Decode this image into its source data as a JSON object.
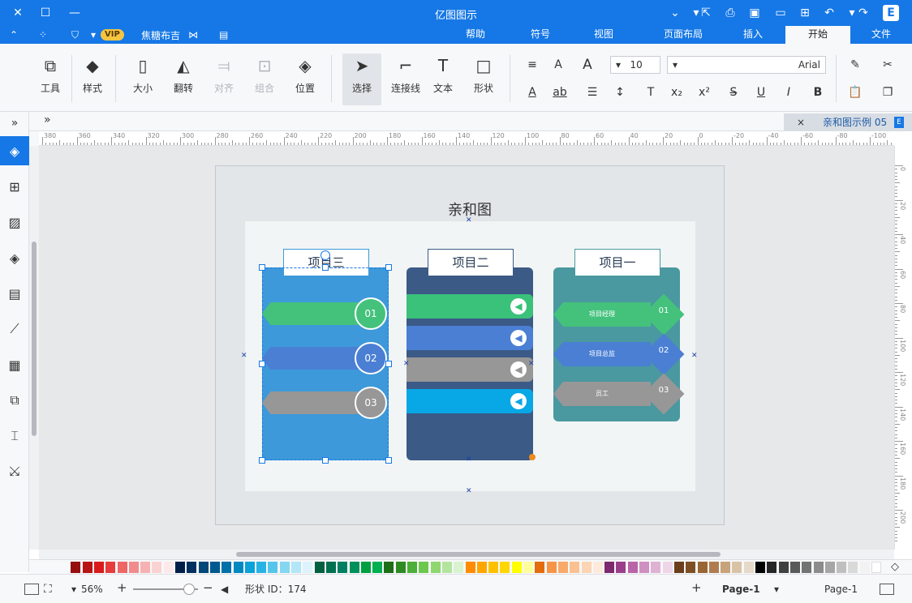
{
  "app_title": "亿图图示",
  "menu_tabs": [
    "文件",
    "开始",
    "插入",
    "页面布局",
    "视图",
    "符号",
    "帮助"
  ],
  "active_tab": "开始",
  "user": {
    "name": "焦糖布吉",
    "vip": "VIP"
  },
  "ribbon": {
    "groups": [
      {
        "label": "工具"
      },
      {
        "label": "样式"
      },
      {
        "label": "大小"
      },
      {
        "label": "翻转"
      },
      {
        "label": "对齐",
        "disabled": true
      },
      {
        "label": "组合",
        "disabled": true
      },
      {
        "label": "位置"
      },
      {
        "label": "选择"
      },
      {
        "label": "连接线"
      },
      {
        "label": "文本"
      },
      {
        "label": "形状"
      }
    ],
    "font_size": "10",
    "font_name": "Arial"
  },
  "document_tab": "亲和图示例 05",
  "ruler": {
    "h_labels": [
      "380",
      "360",
      "340",
      "320",
      "300",
      "280",
      "260",
      "240",
      "220",
      "200",
      "180",
      "160",
      "140",
      "120",
      "100",
      "80",
      "60",
      "40",
      "20",
      "0",
      "-20",
      "-40",
      "-60",
      "-80",
      "-100"
    ],
    "v_labels": [
      "0",
      "20",
      "40",
      "60",
      "80",
      "100",
      "120",
      "140",
      "160",
      "180",
      "200"
    ]
  },
  "diagram": {
    "title": "亲和图",
    "panels": [
      {
        "header": "项目三",
        "color": "#3d99d9",
        "items": [
          {
            "num": "01",
            "color": "#44c27c"
          },
          {
            "num": "02",
            "color": "#4a7fd4"
          },
          {
            "num": "03",
            "color": "#979797"
          }
        ]
      },
      {
        "header": "项目二",
        "color": "#3b5a86",
        "bars": [
          "#3ac17a",
          "#4a7fd4",
          "#979797",
          "#08a7e6"
        ]
      },
      {
        "header": "项目一",
        "color": "#4a98a0",
        "items": [
          {
            "num": "01",
            "label": "项目经理",
            "color": "#44c27c"
          },
          {
            "num": "02",
            "label": "项目总监",
            "color": "#4a7fd4"
          },
          {
            "num": "03",
            "label": "员工",
            "color": "#979797"
          }
        ]
      }
    ]
  },
  "status": {
    "zoom": "56%",
    "shape_id": "形状 ID：174",
    "page_current": "Page-1",
    "page_list": "Page-1"
  },
  "palette_colors": [
    "#ffffff",
    "#f2f2f2",
    "#d9d9d9",
    "#bfbfbf",
    "#a6a6a6",
    "#8c8c8c",
    "#737373",
    "#595959",
    "#404040",
    "#262626",
    "#000000",
    "#e6d9c7",
    "#d9c3a5",
    "#c7a27a",
    "#b07c4f",
    "#996633",
    "#7f4f24",
    "#6b3e1b",
    "#efd5e8",
    "#dfb1d3",
    "#cf8fc0",
    "#b964a8",
    "#9c3f8b",
    "#7d2a6e",
    "#fdeada",
    "#fcd5b5",
    "#fbc08f",
    "#f9a96a",
    "#f79546",
    "#e46c0a",
    "#ffff99",
    "#ffff00",
    "#ffd700",
    "#ffc000",
    "#ffa500",
    "#ff8c00",
    "#d9f2d0",
    "#b3e59f",
    "#8fd76f",
    "#6bc84c",
    "#4caf3a",
    "#2e8b22",
    "#1e6e18",
    "#00b050",
    "#00a040",
    "#00905a",
    "#008060",
    "#007050",
    "#006040",
    "#ddf3fb",
    "#b3e6f6",
    "#85d6f1",
    "#56c5eb",
    "#27b4e5",
    "#0aa2d8",
    "#0089c0",
    "#0070a8",
    "#005a90",
    "#004878",
    "#003060",
    "#001f48",
    "#fde9e9",
    "#fad2d2",
    "#f6b2b2",
    "#f28c8c",
    "#ee6666",
    "#e63c3c",
    "#d91b1b",
    "#b81414",
    "#960f0f"
  ]
}
